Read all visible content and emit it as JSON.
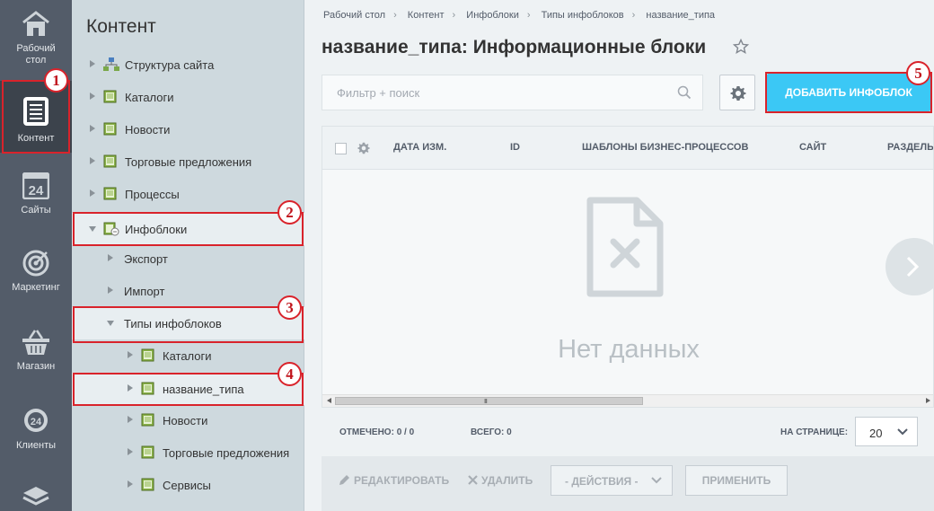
{
  "iconbar": {
    "items": [
      {
        "label": "Рабочий стол",
        "icon": "home-icon"
      },
      {
        "label": "Контент",
        "icon": "document-icon"
      },
      {
        "label": "Сайты",
        "icon": "calendar-24-icon"
      },
      {
        "label": "Маркетинг",
        "icon": "target-icon"
      },
      {
        "label": "Магазин",
        "icon": "basket-icon"
      },
      {
        "label": "Клиенты",
        "icon": "clients-24-icon"
      },
      {
        "label": "",
        "icon": "stack-icon"
      }
    ]
  },
  "tree": {
    "title": "Контент",
    "nodes": [
      {
        "label": "Структура сайта",
        "icon": "site-structure-icon"
      },
      {
        "label": "Каталоги",
        "icon": "book-icon"
      },
      {
        "label": "Новости",
        "icon": "book-icon"
      },
      {
        "label": "Торговые предложения",
        "icon": "book-icon"
      },
      {
        "label": "Процессы",
        "icon": "book-icon"
      },
      {
        "label": "Инфоблоки",
        "icon": "infoblock-icon"
      },
      {
        "label": "Экспорт"
      },
      {
        "label": "Импорт"
      },
      {
        "label": "Типы инфоблоков"
      },
      {
        "label": "Каталоги",
        "icon": "book-icon"
      },
      {
        "label": "название_типа",
        "icon": "book-icon"
      },
      {
        "label": "Новости",
        "icon": "book-icon"
      },
      {
        "label": "Торговые предложения",
        "icon": "book-icon"
      },
      {
        "label": "Сервисы",
        "icon": "book-icon"
      }
    ]
  },
  "breadcrumb": [
    "Рабочий стол",
    "Контент",
    "Инфоблоки",
    "Типы инфоблоков",
    "название_типа"
  ],
  "page": {
    "title": "название_типа: Информационные блоки",
    "filter_placeholder": "Фильтр + поиск",
    "add_button": "ДОБАВИТЬ ИНФОБЛОК"
  },
  "grid": {
    "columns": [
      "ДАТА ИЗМ.",
      "ID",
      "ШАБЛОНЫ БИЗНЕС-ПРОЦЕССОВ",
      "САЙТ",
      "РАЗДЕЛЫ"
    ],
    "empty_text": "Нет данных",
    "scroll_grip": "III"
  },
  "footer": {
    "checked_label": "ОТМЕЧЕНО: 0 / 0",
    "total_label": "ВСЕГО: 0",
    "per_page_label": "НА СТРАНИЦЕ:",
    "per_page_value": "20"
  },
  "actions": {
    "edit": "РЕДАКТИРОВАТЬ",
    "delete": "УДАЛИТЬ",
    "select": "- ДЕЙСТВИЯ -",
    "apply": "ПРИМЕНИТЬ"
  },
  "markers": [
    "1",
    "2",
    "3",
    "4",
    "5"
  ],
  "colors": {
    "highlight": "#d9232b",
    "accent": "#3bc8f5",
    "iconbar": "#535c69",
    "tree_bg": "#ced9de"
  }
}
